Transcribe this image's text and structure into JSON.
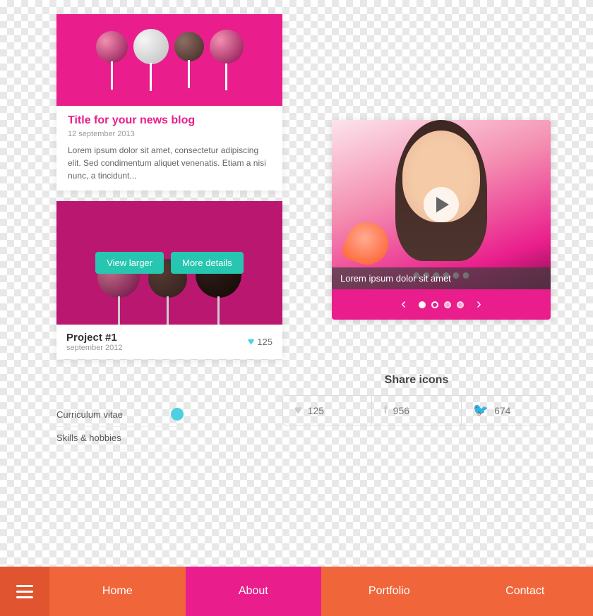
{
  "blog": {
    "title": "Title for your news blog",
    "date": "12 september 2013",
    "excerpt": "Lorem ipsum dolor sit amet, consectetur adipiscing elit. Sed condimentum aliquet venenatis. Etiam a nisi nunc, a tincidunt...",
    "image_alt": "Cake pops on pink background"
  },
  "portfolio": {
    "project_name": "Project #1",
    "project_date": "september 2012",
    "likes": "125",
    "btn_view": "View larger",
    "btn_details": "More details",
    "image_alt": "Cake pops portfolio"
  },
  "sidebar": {
    "items": [
      {
        "label": "Curriculum vitae"
      },
      {
        "label": "Skills & hobbies"
      }
    ]
  },
  "media": {
    "caption": "Lorem ipsum dolor sit amet",
    "image_alt": "Woman with rose"
  },
  "share": {
    "title": "Share icons",
    "heart_count": "125",
    "facebook_count": "956",
    "twitter_count": "674"
  },
  "nav": {
    "menu_label": "☰",
    "items": [
      {
        "label": "Home",
        "active": false
      },
      {
        "label": "About",
        "active": true
      },
      {
        "label": "Portfolio",
        "active": false
      },
      {
        "label": "Contact",
        "active": false
      }
    ]
  },
  "colors": {
    "pink": "#e91e8c",
    "teal": "#26c6b0",
    "orange": "#f0663a",
    "light_blue": "#4dd0e1"
  }
}
